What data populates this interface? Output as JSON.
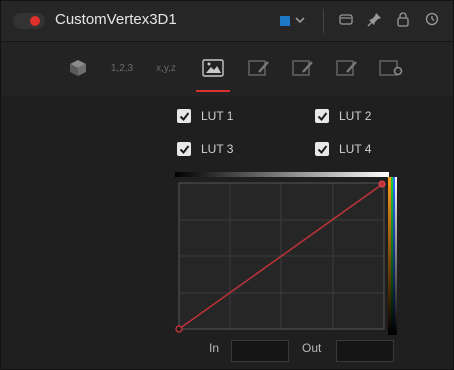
{
  "header": {
    "title": "CustomVertex3D1",
    "color_chip": "#1d79c7",
    "icons": [
      "toggle-switch",
      "chevron-down-icon",
      "window-icon",
      "pin-icon",
      "lock-icon",
      "reset-icon"
    ]
  },
  "tabs": [
    {
      "name": "3d-tab",
      "label": ""
    },
    {
      "name": "numbered-tab",
      "label": "1,2,3"
    },
    {
      "name": "xyz-tab",
      "label": "x,y,z"
    },
    {
      "name": "image-tab",
      "label": ""
    },
    {
      "name": "edit-tab-1",
      "label": ""
    },
    {
      "name": "edit-tab-2",
      "label": ""
    },
    {
      "name": "edit-tab-3",
      "label": ""
    },
    {
      "name": "settings-tab",
      "label": ""
    }
  ],
  "active_tab": 3,
  "luts": [
    {
      "label": "LUT 1",
      "checked": true
    },
    {
      "label": "LUT 2",
      "checked": true
    },
    {
      "label": "LUT 3",
      "checked": true
    },
    {
      "label": "LUT 4",
      "checked": true
    }
  ],
  "curve": {
    "line_color": "#c0323a",
    "points": [
      [
        0,
        0
      ],
      [
        1,
        1
      ]
    ]
  },
  "io": {
    "in_label": "In",
    "out_label": "Out",
    "in_value": "",
    "out_value": ""
  }
}
